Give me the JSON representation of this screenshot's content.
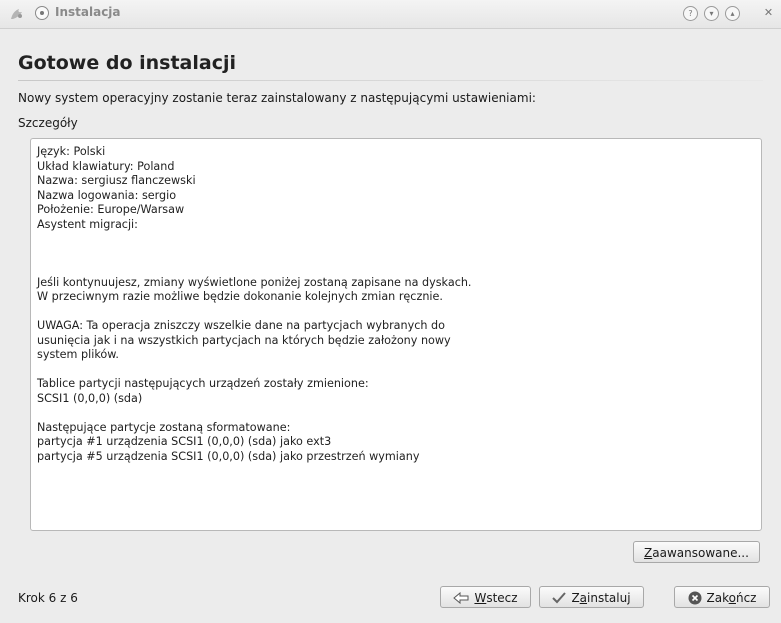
{
  "window": {
    "title": "Instalacja"
  },
  "page": {
    "heading": "Gotowe do instalacji",
    "intro": "Nowy system operacyjny zostanie teraz zainstalowany z następującymi ustawieniami:",
    "details_label": "Szczegóły",
    "details_text": "Język: Polski\nUkład klawiatury: Poland\nNazwa: sergiusz flanczewski\nNazwa logowania: sergio\nPołożenie: Europe/Warsaw\nAsystent migracji:\n\n\n\nJeśli kontynuujesz, zmiany wyświetlone poniżej zostaną zapisane na dyskach.\nW przeciwnym razie możliwe będzie dokonanie kolejnych zmian ręcznie.\n\nUWAGA: Ta operacja zniszczy wszelkie dane na partycjach wybranych do\nusunięcia jak i na wszystkich partycjach na których będzie założony nowy\nsystem plików.\n\nTablice partycji następujących urządzeń zostały zmienione:\nSCSI1 (0,0,0) (sda)\n\nNastępujące partycje zostaną sformatowane:\npartycja #1 urządzenia SCSI1 (0,0,0) (sda) jako ext3\npartycja #5 urządzenia SCSI1 (0,0,0) (sda) jako przestrzeń wymiany"
  },
  "buttons": {
    "advanced": {
      "mnemonic": "Z",
      "rest": "aawansowane..."
    },
    "back": {
      "mnemonic": "W",
      "rest": "stecz"
    },
    "install": {
      "mnemonic": "a",
      "before": "Z",
      "rest": "instaluj"
    },
    "quit": {
      "before": "Zak",
      "mnemonic": "o",
      "rest": "ńcz"
    }
  },
  "footer": {
    "step": "Krok 6 z 6"
  }
}
